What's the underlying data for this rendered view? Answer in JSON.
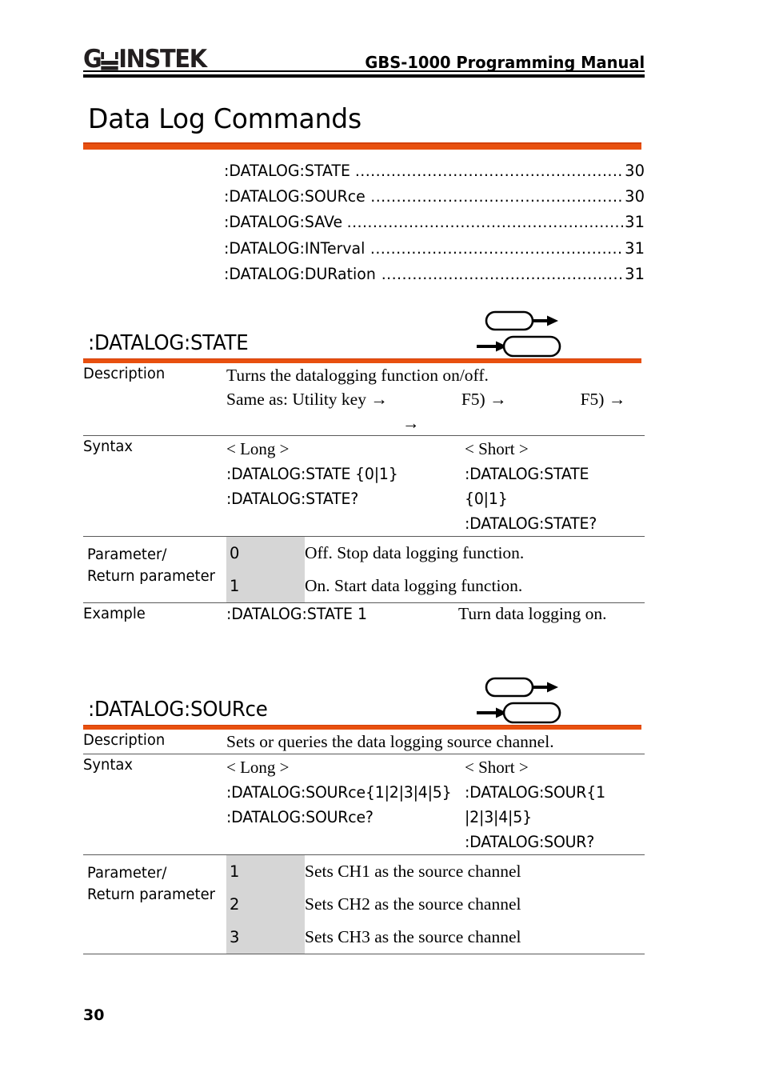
{
  "header": {
    "logo_text": "GW INSTEK",
    "logo_part1": "G",
    "logo_part2": "INSTEK",
    "manual_title": "GBS-1000 Programming Manual"
  },
  "page_title": "Data Log Commands",
  "accent_color": "#e8500f",
  "shade_color": "#d6d6d6",
  "toc": {
    "entries": [
      {
        "label": ":DATALOG:STATE",
        "dots": "........................................................",
        "page": "30"
      },
      {
        "label": ":DATALOG:SOURce",
        "dots": "....................................................",
        "page": "30"
      },
      {
        "label": ":DATALOG:SAVe",
        "dots": "........................................................",
        "page": "31"
      },
      {
        "label": ":DATALOG:INTerval",
        "dots": "..................................................",
        "page": "31"
      },
      {
        "label": ":DATALOG:DURation",
        "dots": ".................................................",
        "page": "31"
      }
    ]
  },
  "sections": [
    {
      "name": ":DATALOG:STATE",
      "icons": {
        "set": "set-command-icon",
        "query": "query-command-icon"
      },
      "labels": {
        "description": "Description",
        "syntax": "Syntax",
        "parameter": "Parameter/",
        "parameter2": "Return parameter",
        "example": "Example"
      },
      "description": {
        "line1": "Turns the datalogging function on/off.",
        "same_as_prefix": "Same as: Utility key →",
        "same_as_mid": "F5) →",
        "same_as_end": "F5) →",
        "same_as_cont": "→"
      },
      "syntax": {
        "long_header": "< Long >",
        "short_header": "< Short >",
        "long_lines": [
          ":DATALOG:STATE {0|1}",
          ":DATALOG:STATE?"
        ],
        "short_lines": [
          ":DATALOG:STATE {0|1}",
          ":DATALOG:STATE?"
        ]
      },
      "parameters": [
        {
          "key": "0",
          "desc": "Off. Stop data logging function."
        },
        {
          "key": "1",
          "desc": "On. Start data logging function."
        }
      ],
      "example": {
        "command": ":DATALOG:STATE 1",
        "note": "Turn data logging on."
      }
    },
    {
      "name": ":DATALOG:SOURce",
      "icons": {
        "set": "set-command-icon",
        "query": "query-command-icon"
      },
      "labels": {
        "description": "Description",
        "syntax": "Syntax",
        "parameter": "Parameter/",
        "parameter2": "Return parameter"
      },
      "description": {
        "line1": "Sets or queries the data logging source channel."
      },
      "syntax": {
        "long_header": "< Long >",
        "short_header": "< Short >",
        "long_lines": [
          ":DATALOG:SOURce{1|2|3|4|5}",
          ":DATALOG:SOURce?"
        ],
        "short_lines": [
          ":DATALOG:SOUR{1|2|3|4|5}",
          ":DATALOG:SOUR?"
        ]
      },
      "parameters": [
        {
          "key": "1",
          "desc": "Sets CH1 as the source channel"
        },
        {
          "key": "2",
          "desc": "Sets CH2 as the source channel"
        },
        {
          "key": "3",
          "desc": "Sets CH3 as the source channel"
        }
      ]
    }
  ],
  "footer": {
    "page_number": "30"
  }
}
